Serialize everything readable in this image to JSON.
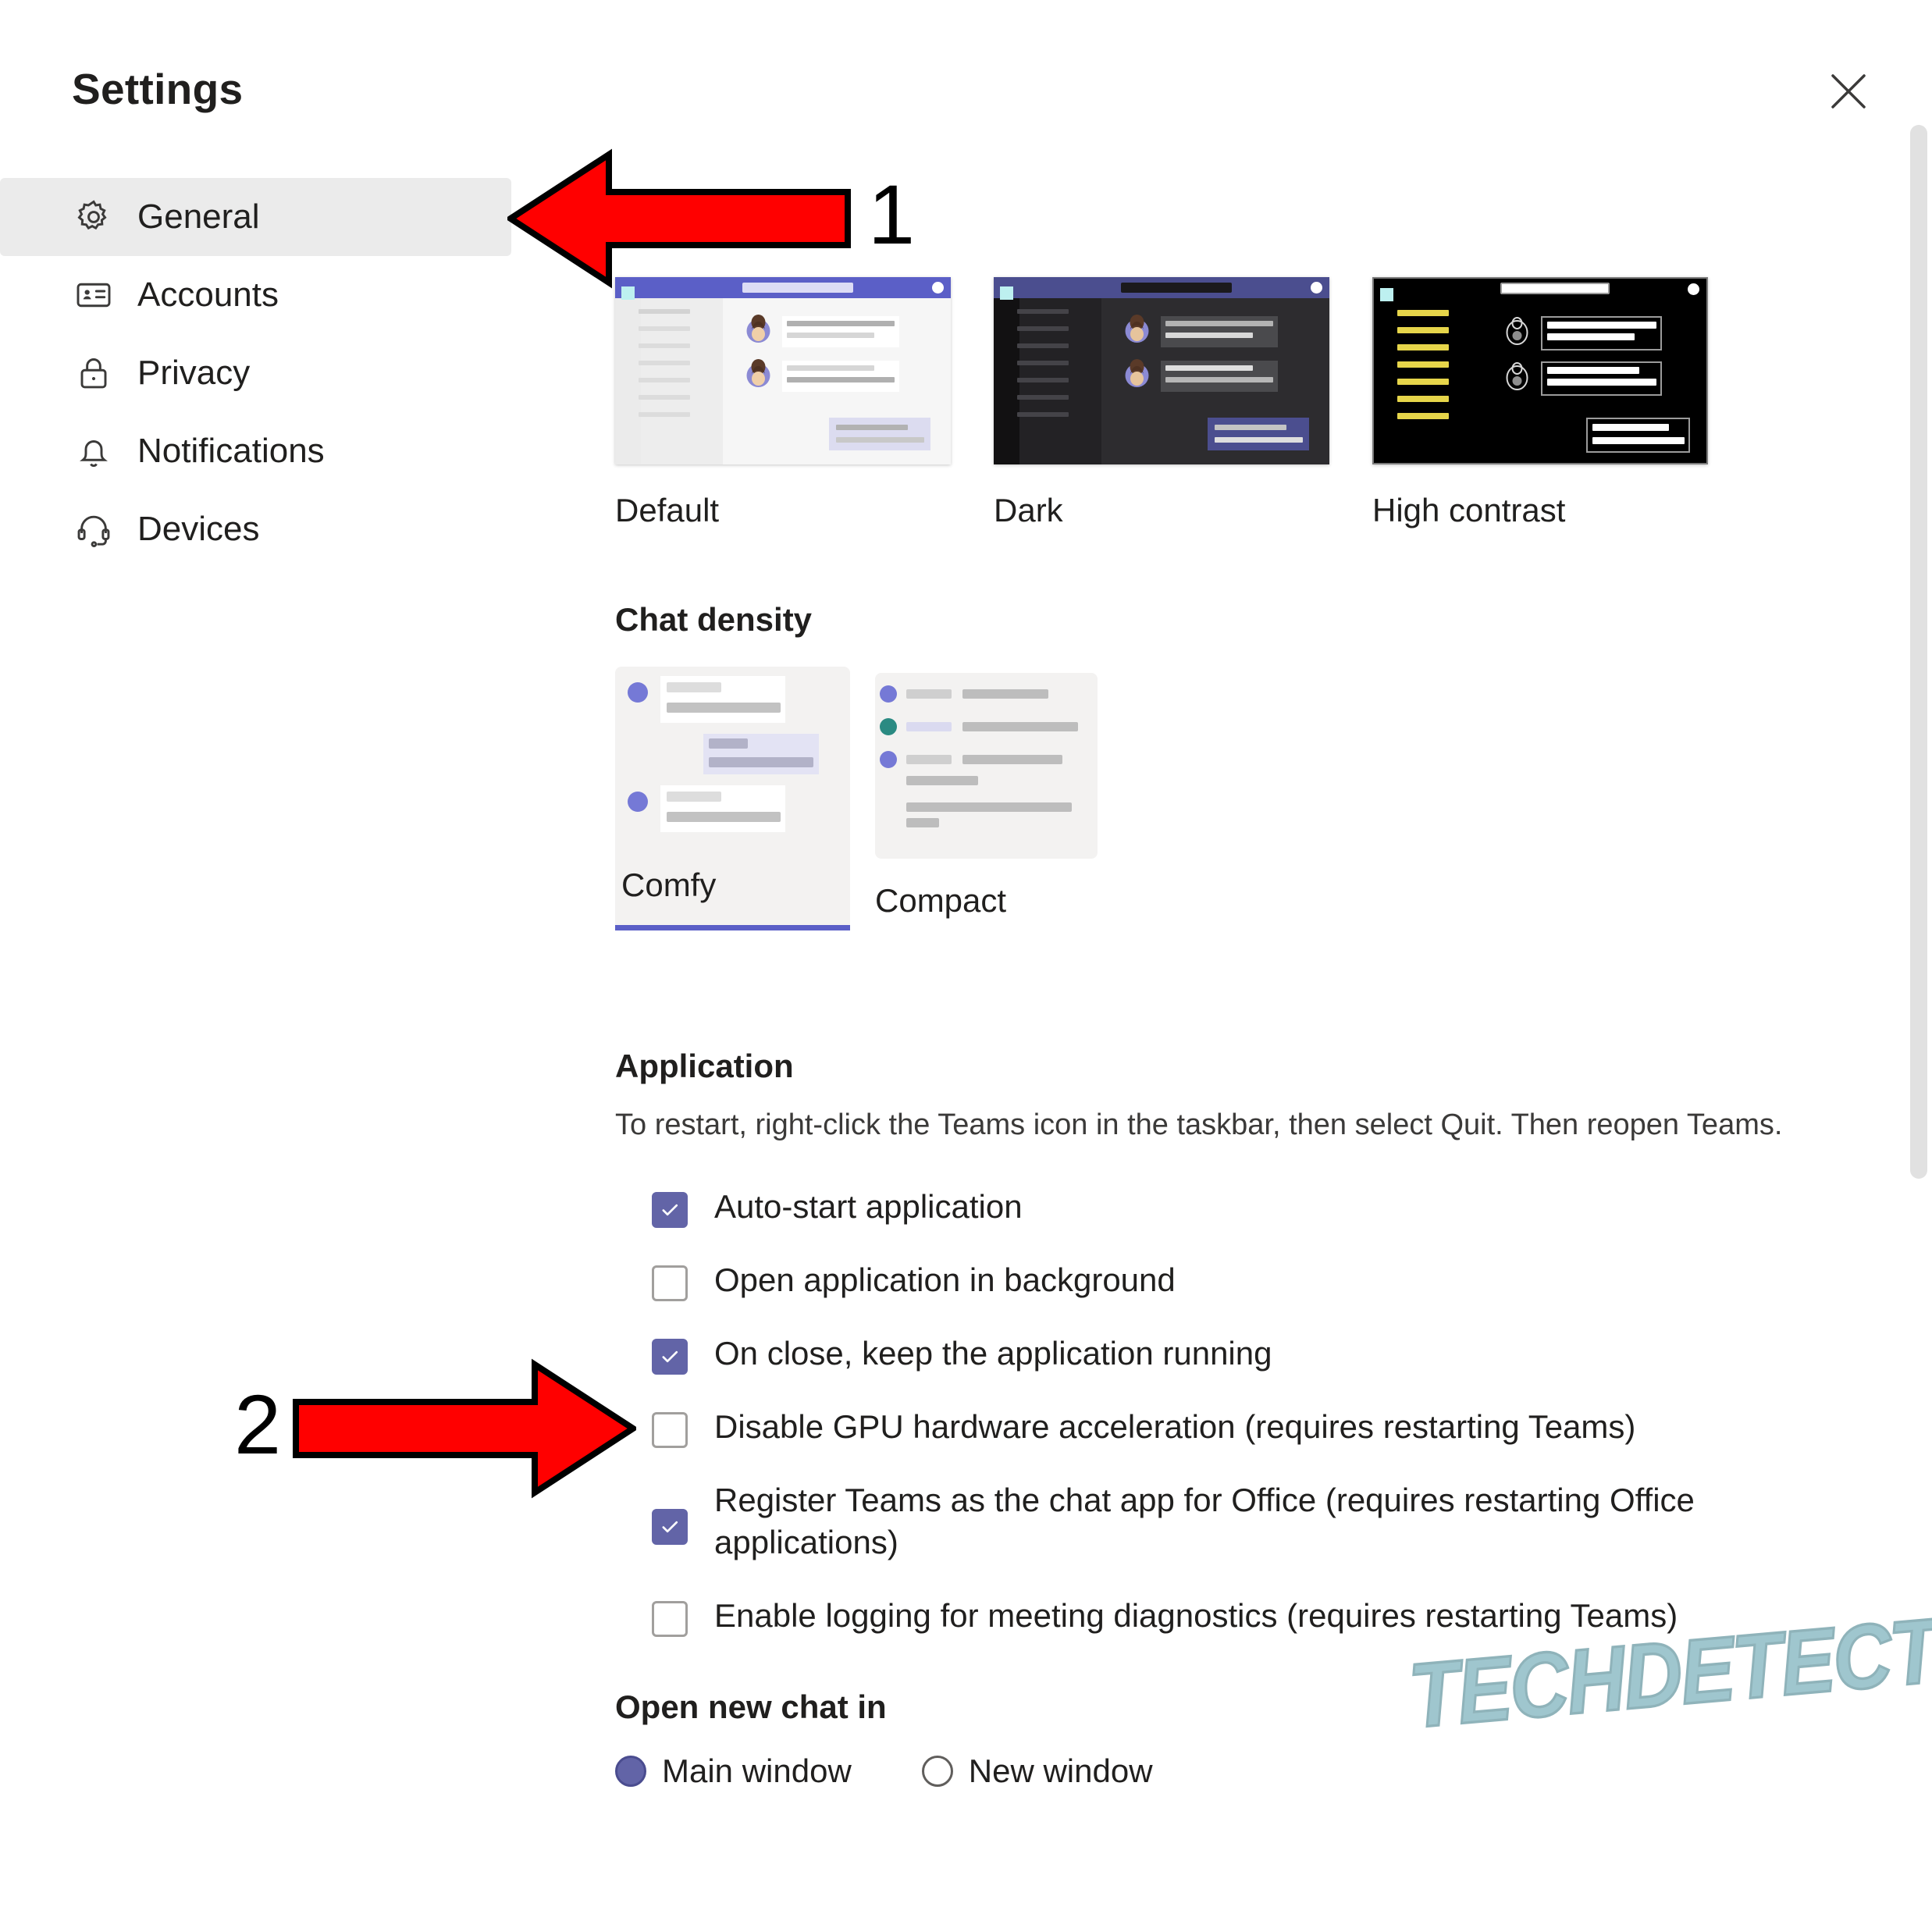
{
  "window": {
    "title": "Settings",
    "close_icon": "close-icon"
  },
  "sidebar": {
    "items": [
      {
        "label": "General",
        "icon": "gear-icon",
        "active": true
      },
      {
        "label": "Accounts",
        "icon": "id-card-icon",
        "active": false
      },
      {
        "label": "Privacy",
        "icon": "lock-icon",
        "active": false
      },
      {
        "label": "Notifications",
        "icon": "bell-icon",
        "active": false
      },
      {
        "label": "Devices",
        "icon": "headset-icon",
        "active": false
      }
    ]
  },
  "theme": {
    "options": [
      {
        "label": "Default"
      },
      {
        "label": "Dark"
      },
      {
        "label": "High contrast"
      }
    ]
  },
  "chat_density": {
    "title": "Chat density",
    "options": [
      {
        "label": "Comfy",
        "selected": true
      },
      {
        "label": "Compact",
        "selected": false
      }
    ]
  },
  "application": {
    "title": "Application",
    "hint": "To restart, right-click the Teams icon in the taskbar, then select Quit. Then reopen Teams.",
    "checkboxes": [
      {
        "label": "Auto-start application",
        "checked": true
      },
      {
        "label": "Open application in background",
        "checked": false
      },
      {
        "label": "On close, keep the application running",
        "checked": true
      },
      {
        "label": "Disable GPU hardware acceleration (requires restarting Teams)",
        "checked": false
      },
      {
        "label": "Register Teams as the chat app for Office (requires restarting Office applications)",
        "checked": true
      },
      {
        "label": "Enable logging for meeting diagnostics (requires restarting Teams)",
        "checked": false
      }
    ]
  },
  "open_new_chat_in": {
    "title": "Open new chat in",
    "options": [
      {
        "label": "Main window",
        "selected": true
      },
      {
        "label": "New window",
        "selected": false
      }
    ]
  },
  "annotations": [
    {
      "number": "1",
      "direction": "left"
    },
    {
      "number": "2",
      "direction": "right"
    }
  ],
  "watermark": {
    "text": "TECHDETECTIVE"
  },
  "colors": {
    "accent": "#6264a7",
    "accent_light": "#7579d6",
    "annotation": "#ff0000",
    "selected_nav_bg": "#ebebeb",
    "watermark": "#9fc6ce"
  }
}
